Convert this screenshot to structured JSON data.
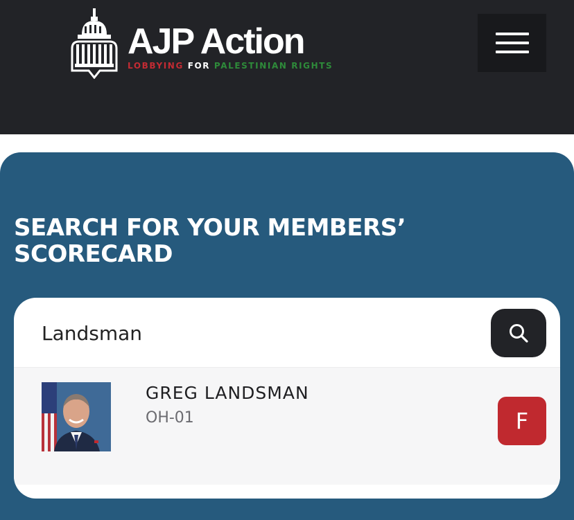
{
  "header": {
    "logo_title": "AJP Action",
    "logo_tagline": {
      "part1": "LOBBYING",
      "part2": "FOR",
      "part3": "PALESTINIAN RIGHTS"
    },
    "menu_icon": "hamburger-icon"
  },
  "colors": {
    "header_bg": "#222327",
    "panel_bg": "#265a7d",
    "grade_red": "#c0292f",
    "tag_red": "#c32b33",
    "tag_green": "#2e8b3a"
  },
  "main": {
    "title_line1": "SEARCH FOR YOUR MEMBERS’",
    "title_line2": "SCORECARD",
    "search": {
      "value": "Landsman",
      "icon": "search-icon"
    },
    "results": [
      {
        "name": "GREG LANDSMAN",
        "district": "OH-01",
        "grade": "F"
      }
    ]
  }
}
